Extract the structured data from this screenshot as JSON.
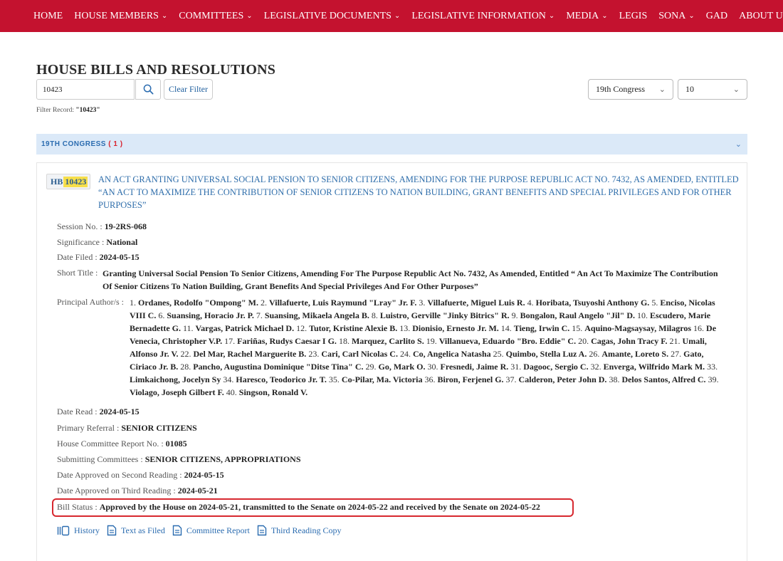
{
  "nav": {
    "items": [
      {
        "label": "HOME",
        "dropdown": false
      },
      {
        "label": "HOUSE MEMBERS",
        "dropdown": true
      },
      {
        "label": "COMMITTEES",
        "dropdown": true
      },
      {
        "label": "LEGISLATIVE DOCUMENTS",
        "dropdown": true
      },
      {
        "label": "LEGISLATIVE INFORMATION",
        "dropdown": true
      },
      {
        "label": "MEDIA",
        "dropdown": true
      },
      {
        "label": "LEGIS",
        "dropdown": false
      },
      {
        "label": "SONA",
        "dropdown": true
      },
      {
        "label": "GAD",
        "dropdown": false
      },
      {
        "label": "ABOUT US",
        "dropdown": true
      }
    ],
    "chevron": "⌄"
  },
  "page": {
    "title": "HOUSE BILLS AND RESOLUTIONS",
    "search_value": "10423",
    "clear_label": "Clear Filter",
    "congress_select": "19th Congress",
    "page_size_select": "10",
    "filter_label": "Filter Record: ",
    "filter_value": "\"10423\""
  },
  "accordion": {
    "label": "19TH CONGRESS",
    "count": "( 1 )"
  },
  "bill": {
    "prefix": "HB",
    "number": "10423",
    "title": "AN ACT GRANTING UNIVERSAL SOCIAL PENSION TO SENIOR CITIZENS, AMENDING FOR THE PURPOSE REPUBLIC ACT NO. 7432, AS AMENDED, ENTITLED “AN ACT TO MAXIMIZE THE CONTRIBUTION OF SENIOR CITIZENS TO NATION BUILDING, GRANT BENEFITS AND SPECIAL PRIVILEGES AND FOR OTHER PURPOSES”",
    "session_label": "Session No. : ",
    "session_value": "19-2RS-068",
    "significance_label": "Significance : ",
    "significance_value": "National",
    "date_filed_label": "Date Filed : ",
    "date_filed_value": "2024-05-15",
    "short_title_label": "Short Title : ",
    "short_title_value": "Granting Universal Social Pension To Senior Citizens, Amending For The Purpose Republic Act No. 7432, As Amended, Entitled “ An Act To Maximize The Contribution Of Senior Citizens To Nation Building, Grant Benefits And Special Privileges And For Other Purposes”",
    "authors_label": "Principal Author/s : ",
    "authors": [
      "Ordanes, Rodolfo \"Ompong\" M.",
      "Villafuerte, Luis Raymund \"Lray\" Jr. F.",
      "Villafuerte, Miguel Luis R.",
      "Horibata, Tsuyoshi Anthony G.",
      "Enciso, Nicolas VIII C.",
      "Suansing, Horacio Jr. P.",
      "Suansing, Mikaela Angela B.",
      "Luistro, Gerville \"Jinky Bitrics\" R.",
      "Bongalon, Raul Angelo \"Jil\" D.",
      "Escudero, Marie Bernadette G.",
      "Vargas, Patrick Michael D.",
      "Tutor, Kristine Alexie B.",
      "Dionisio, Ernesto Jr. M.",
      "Tieng, Irwin C.",
      "Aquino-Magsaysay, Milagros",
      "De Venecia, Christopher V.P.",
      "Fariñas, Rudys Caesar I G.",
      "Marquez, Carlito S.",
      "Villanueva, Eduardo \"Bro. Eddie\" C.",
      "Cagas, John Tracy F.",
      "Umali, Alfonso Jr. V.",
      "Del Mar, Rachel Marguerite B.",
      "Cari, Carl Nicolas C.",
      "Co, Angelica Natasha",
      "Quimbo, Stella Luz A.",
      "Amante, Loreto S.",
      "Gato, Ciriaco Jr. B.",
      "Pancho, Augustina Dominique \"Ditse Tina\" C.",
      "Go, Mark O.",
      "Fresnedi, Jaime R.",
      "Dagooc, Sergio C.",
      "Enverga, Wilfrido Mark M.",
      "Limkaichong, Jocelyn Sy",
      "Haresco, Teodorico Jr. T.",
      "Co-Pilar, Ma. Victoria",
      "Biron, Ferjenel G.",
      "Calderon, Peter John D.",
      "Delos Santos, Alfred C.",
      "Violago, Joseph Gilbert F.",
      "Singson, Ronald V."
    ],
    "date_read_label": "Date Read : ",
    "date_read_value": "2024-05-15",
    "primary_referral_label": "Primary Referral : ",
    "primary_referral_value": "SENIOR CITIZENS",
    "committee_report_label": "House Committee Report No. : ",
    "committee_report_value": "01085",
    "submitting_label": "Submitting Committees : ",
    "submitting_value": "SENIOR CITIZENS, APPROPRIATIONS",
    "second_reading_label": "Date Approved on Second Reading : ",
    "second_reading_value": "2024-05-15",
    "third_reading_label": "Date Approved on Third Reading : ",
    "third_reading_value": "2024-05-21",
    "status_label": "Bill Status : ",
    "status_value": "Approved by the House on 2024-05-21, transmitted to the Senate on 2024-05-22 and received by the Senate on 2024-05-22"
  },
  "links": {
    "history": "History",
    "text_filed": "Text as Filed",
    "committee_report": "Committee Report",
    "third_reading_copy": "Third Reading Copy"
  },
  "colors": {
    "nav_bg": "#c4122f",
    "link_blue": "#2f6eab",
    "accordion_bg": "#dbe9f8",
    "highlight": "#f7df4a",
    "status_border": "#d7282f"
  }
}
